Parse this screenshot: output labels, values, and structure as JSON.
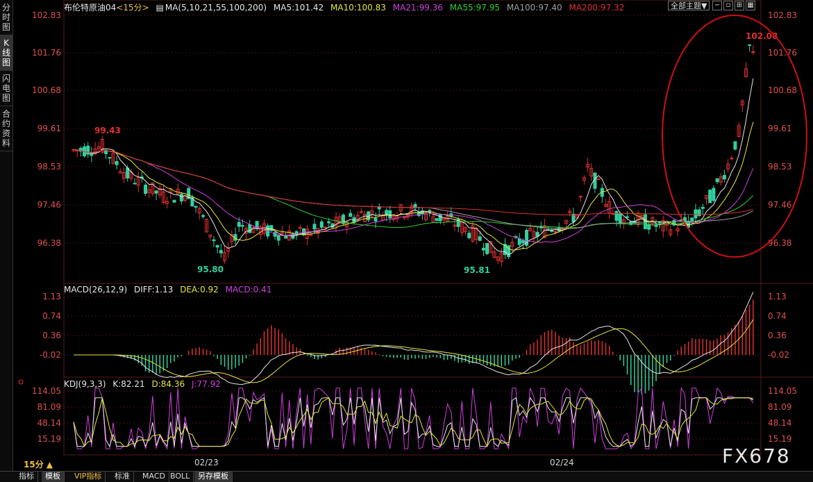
{
  "sidebar": {
    "items": [
      {
        "label": "分时图"
      },
      {
        "label": "K线图"
      },
      {
        "label": "闪电图"
      },
      {
        "label": "合约资料"
      }
    ]
  },
  "price_panel": {
    "instrument": "布伦特原油04",
    "period": "<15分>",
    "ma_header": "MA(5,10,21,55,100,200)",
    "ma": [
      {
        "text": "MA5:101.42",
        "color": "#e8e8e8"
      },
      {
        "text": "MA10:100.83",
        "color": "#e8e838"
      },
      {
        "text": "MA21:99.36",
        "color": "#d040e0"
      },
      {
        "text": "MA55:97.95",
        "color": "#30d030"
      },
      {
        "text": "MA100:97.40",
        "color": "#a0a0a0"
      },
      {
        "text": "MA200:97.32",
        "color": "#e03030"
      }
    ],
    "period_select": "全部主题▼",
    "axis_ticks": [
      "102.83",
      "101.76",
      "100.68",
      "99.61",
      "98.53",
      "97.46",
      "96.38"
    ],
    "annotations": {
      "high": "102.08",
      "left_high": "99.43",
      "low1": "95.80",
      "low2": "95.81"
    }
  },
  "macd_panel": {
    "header": "MACD(26,12,9)",
    "diff": "DIFF:1.13",
    "dea": "DEA:0.92",
    "macd": "MACD:0.41",
    "axis_ticks": [
      "1.13",
      "0.74",
      "0.36",
      "-0.02"
    ]
  },
  "kdj_panel": {
    "header": "KDJ(9,3,3)",
    "k": "K:82.21",
    "d": "D:84.36",
    "j": "J:77.92",
    "axis_ticks": [
      "114.05",
      "81.09",
      "48.14",
      "15.19"
    ]
  },
  "x_axis": {
    "labels": [
      "02/23",
      "02/24"
    ]
  },
  "period_label": "15分 ▲",
  "bottom_tabs": [
    {
      "label": "指标"
    },
    {
      "label": "模板"
    },
    {
      "label": "VIP指标"
    },
    {
      "label": "标准"
    },
    {
      "label": "MACD"
    },
    {
      "label": "BOLL"
    },
    {
      "label": "另存模板"
    }
  ],
  "watermark": "FX678",
  "colors": {
    "up": "#e03030",
    "down": "#30d0a0",
    "axis": "#e05050",
    "grid": "#3a1a1a",
    "highlight_circle": "#d01010"
  }
}
